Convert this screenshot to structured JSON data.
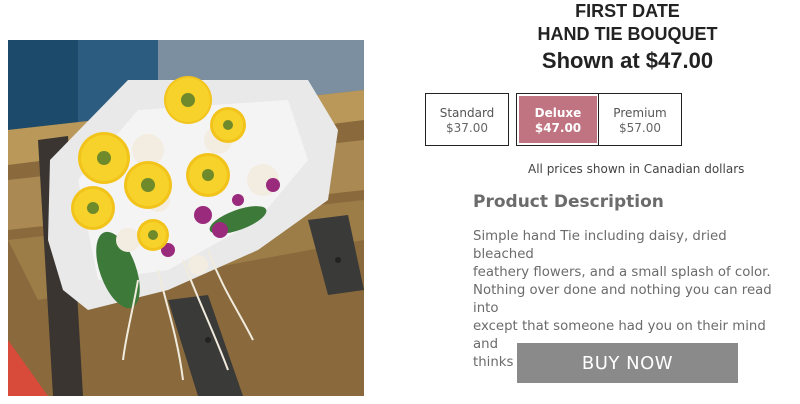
{
  "product": {
    "title_line1": "FIRST DATE",
    "title_line2": "HAND TIE BOUQUET",
    "shown_price": "Shown at $47.00"
  },
  "options": [
    {
      "name": "Standard",
      "price": "$37.00",
      "selected": false
    },
    {
      "name": "Deluxe",
      "price": "$47.00",
      "selected": true
    },
    {
      "name": "Premium",
      "price": "$57.00",
      "selected": false
    }
  ],
  "currency_note": "All prices shown in Canadian dollars",
  "description": {
    "heading": "Product Description",
    "lines": [
      "Simple hand Tie including daisy, dried bleached",
      "feathery flowers, and a small splash of color.",
      "Nothing over done and nothing you can read into",
      "except that someone had you on their mind and",
      "thinks your special."
    ]
  },
  "buy_button": {
    "label": "BUY NOW"
  },
  "colors": {
    "selected_option": "#c07482",
    "buy_button": "#8a8a8a"
  }
}
